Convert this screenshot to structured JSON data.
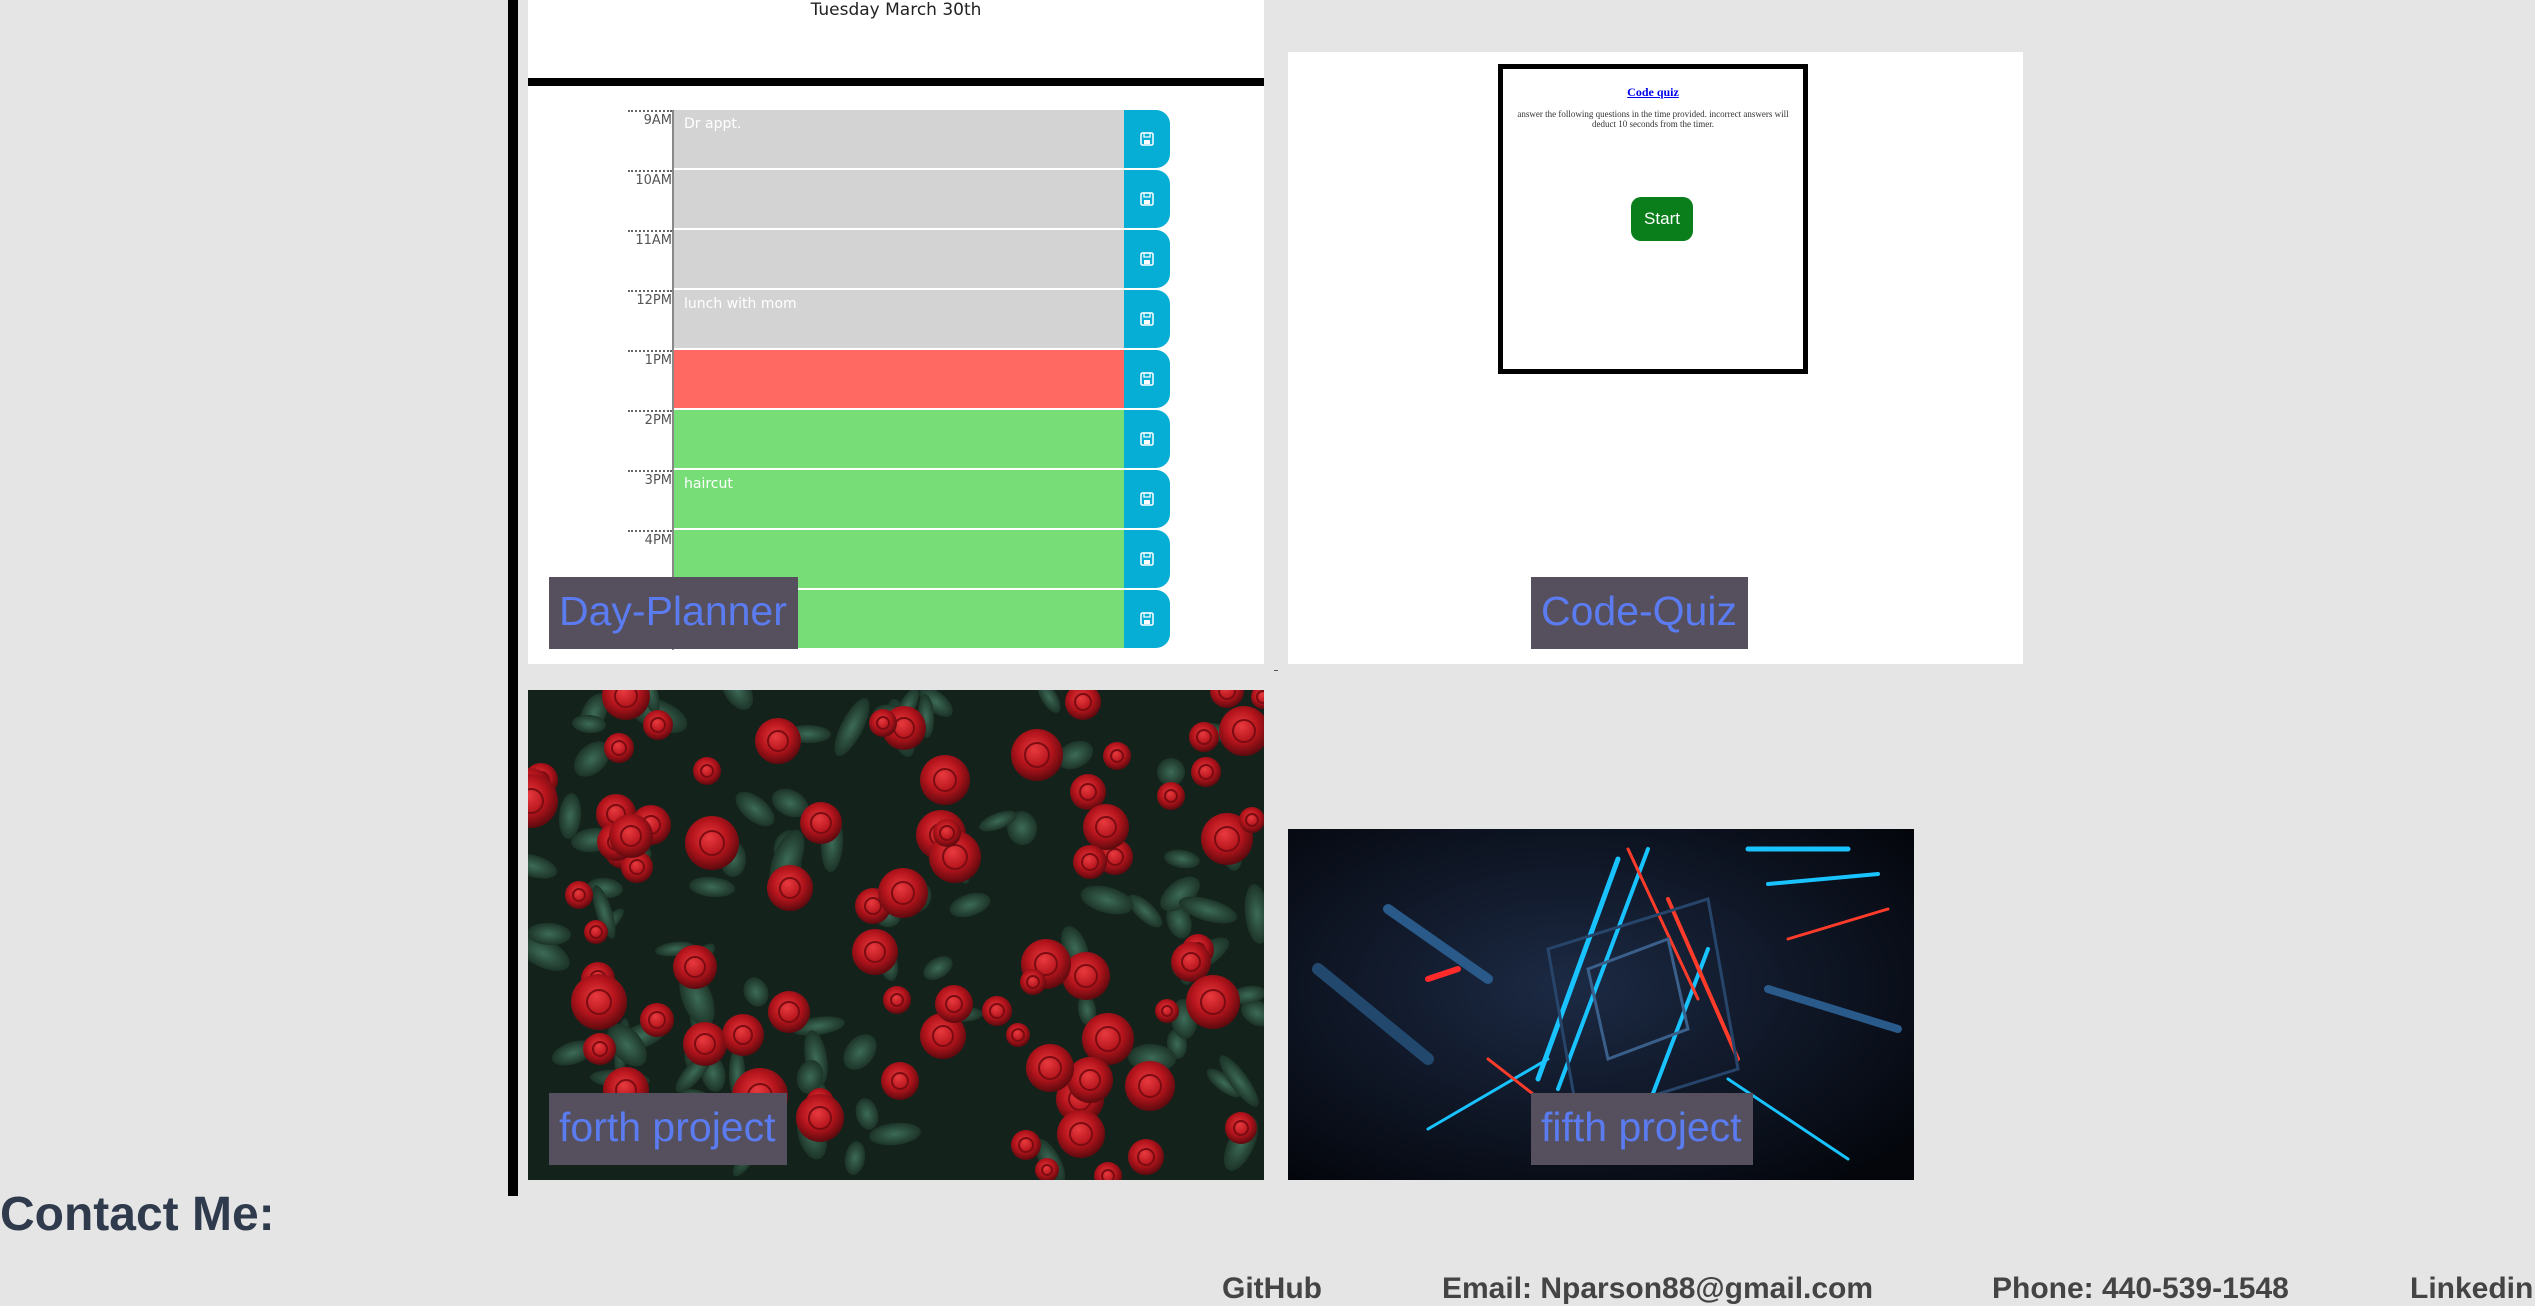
{
  "planner": {
    "date": "Tuesday March 30th",
    "hours": [
      {
        "label": "9AM",
        "text": "Dr appt.",
        "state": "past"
      },
      {
        "label": "10AM",
        "text": "",
        "state": "past"
      },
      {
        "label": "11AM",
        "text": "",
        "state": "past"
      },
      {
        "label": "12PM",
        "text": "lunch with mom",
        "state": "past"
      },
      {
        "label": "1PM",
        "text": "",
        "state": "present"
      },
      {
        "label": "2PM",
        "text": "",
        "state": "future"
      },
      {
        "label": "3PM",
        "text": "haircut",
        "state": "future"
      },
      {
        "label": "4PM",
        "text": "",
        "state": "future"
      },
      {
        "label": "",
        "text": "",
        "state": "future"
      }
    ]
  },
  "quiz": {
    "title": "Code quiz",
    "description": "answer the following questions in the time provided. incorrect answers will deduct 10 seconds from the timer.",
    "start_label": "Start"
  },
  "projects": {
    "p1": "Day-Planner",
    "p2": "Code-Quiz",
    "p4": "forth project",
    "p5": "fifth project"
  },
  "contact": {
    "heading": "Contact Me:",
    "github": "GitHub",
    "email": "Email: Nparson88@gmail.com",
    "phone": "Phone: 440-539-1548",
    "linkedin": "Linkedin"
  },
  "colors": {
    "background": "#e5e5e5",
    "label_bg": "#56505e",
    "label_text": "#5b7bf0",
    "save_button": "#06aed5",
    "past": "#d3d3d3",
    "present": "#ff6961",
    "future": "#77dd77",
    "start_button": "#0b7e1c"
  }
}
